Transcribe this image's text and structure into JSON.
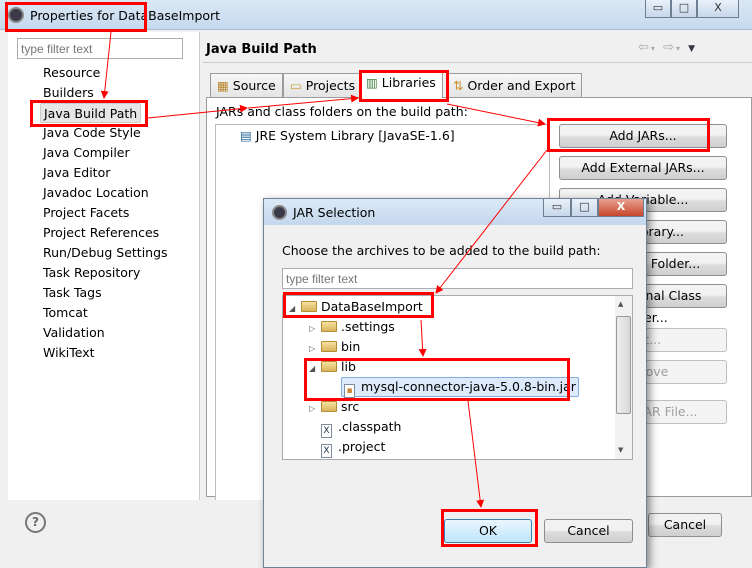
{
  "window": {
    "title": "Properties for DataBaseImport",
    "min": "▭",
    "max": "□",
    "close": "X"
  },
  "sidebar": {
    "filter_placeholder": "type filter text",
    "items": [
      "Resource",
      "Builders",
      "Java Build Path",
      "Java Code Style",
      "Java Compiler",
      "Java Editor",
      "Javadoc Location",
      "Project Facets",
      "Project References",
      "Run/Debug Settings",
      "Task Repository",
      "Task Tags",
      "Tomcat",
      "Validation",
      "WikiText"
    ],
    "selected": "Java Build Path"
  },
  "page": {
    "title": "Java Build Path",
    "nav": {
      "back": "⇦",
      "forward": "⇨",
      "menu": "▼",
      "dropdown": "▾"
    }
  },
  "tabs": [
    {
      "label": "Source"
    },
    {
      "label": "Projects"
    },
    {
      "label": "Libraries"
    },
    {
      "label": "Order and Export"
    }
  ],
  "active_tab": "Libraries",
  "libraries": {
    "caption": "JARs and class folders on the build path:",
    "entries": [
      "JRE System Library [JavaSE-1.6]"
    ],
    "buttons": [
      "Add JARs...",
      "Add External JARs...",
      "Add Variable...",
      "Add Library...",
      "Add Class Folder...",
      "Add External Class Folder...",
      "Edit...",
      "Remove",
      "Migrate JAR File..."
    ]
  },
  "footer": {
    "help": "?",
    "cancel": "Cancel"
  },
  "dialog": {
    "title": "JAR Selection",
    "prompt": "Choose the archives to be added to the build path:",
    "filter_placeholder": "type filter text",
    "tree": [
      {
        "label": "DataBaseImport",
        "twisty": "◢",
        "kind": "project"
      },
      {
        "label": ".settings",
        "twisty": "▷",
        "kind": "folder"
      },
      {
        "label": "bin",
        "twisty": "▷",
        "kind": "folder"
      },
      {
        "label": "lib",
        "twisty": "◢",
        "kind": "folder"
      },
      {
        "label": "mysql-connector-java-5.0.8-bin.jar",
        "twisty": "",
        "kind": "jar",
        "selected": true
      },
      {
        "label": "src",
        "twisty": "▷",
        "kind": "folder"
      },
      {
        "label": ".classpath",
        "twisty": "",
        "kind": "xfile"
      },
      {
        "label": ".project",
        "twisty": "",
        "kind": "xfile"
      }
    ],
    "ok": "OK",
    "cancel": "Cancel",
    "min": "▭",
    "max": "□",
    "close": "X"
  },
  "colors": {
    "annotation": "#ff0000",
    "selection": "#dceafc"
  }
}
